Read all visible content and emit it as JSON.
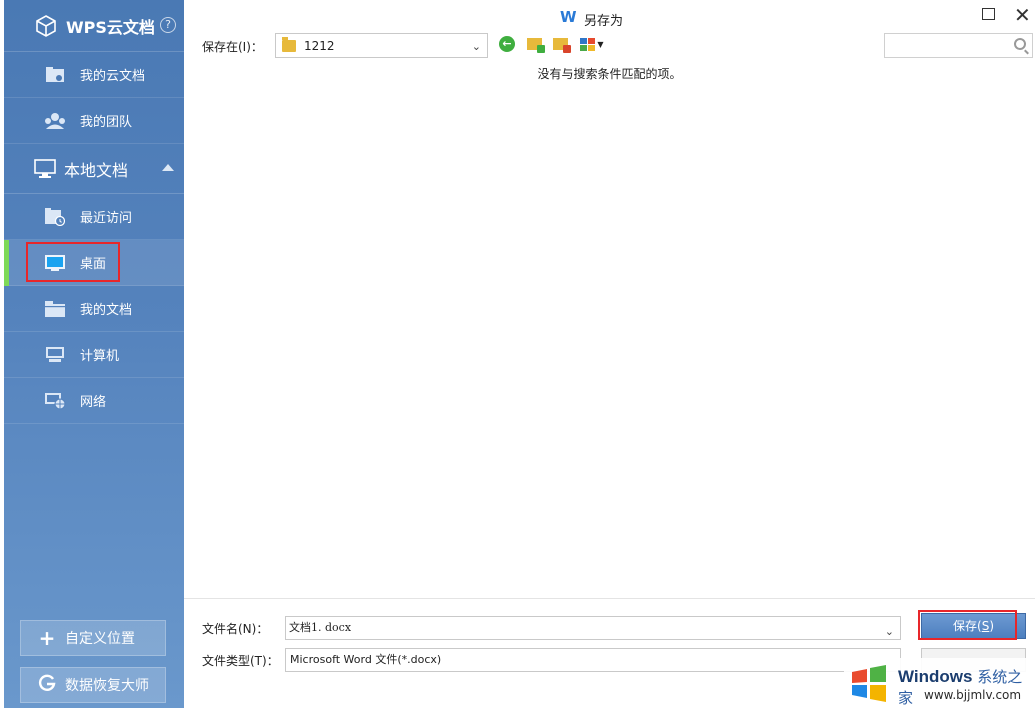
{
  "sidebar": {
    "header_title": "WPS云文档",
    "help_glyph": "?",
    "cloud_items": [
      {
        "label": "我的云文档",
        "icon": "cloud-doc-icon"
      },
      {
        "label": "我的团队",
        "icon": "team-icon"
      }
    ],
    "local_section": "本地文档",
    "local_items": [
      {
        "label": "最近访问",
        "icon": "recent-folder-icon"
      },
      {
        "label": "桌面",
        "icon": "desktop-icon"
      },
      {
        "label": "我的文档",
        "icon": "documents-folder-icon"
      },
      {
        "label": "计算机",
        "icon": "computer-icon"
      },
      {
        "label": "网络",
        "icon": "network-icon"
      }
    ],
    "active_item": "桌面",
    "custom_location_label": "自定义位置",
    "data_recovery_label": "数据恢复大师"
  },
  "window": {
    "title": "另存为",
    "app_logo": "W",
    "accent_color": "#4a79b4",
    "highlight_color": "#e8262a"
  },
  "toolbar": {
    "save_in_label": "保存在(I)：",
    "location_value": "1212",
    "search_placeholder": ""
  },
  "file_list": {
    "empty_message": "没有与搜索条件匹配的项。"
  },
  "bottom": {
    "filename_label": "文件名(N)：",
    "filename_value": "文档1. docx",
    "filetype_label": "文件类型(T)：",
    "filetype_value": "Microsoft Word 文件(*.docx)",
    "save_label_prefix": "保存(",
    "save_label_key": "S",
    "save_label_suffix": ")"
  },
  "watermark": {
    "title": "Windows",
    "title_cn": "系统之家",
    "url": "www.bjjmlv.com"
  }
}
